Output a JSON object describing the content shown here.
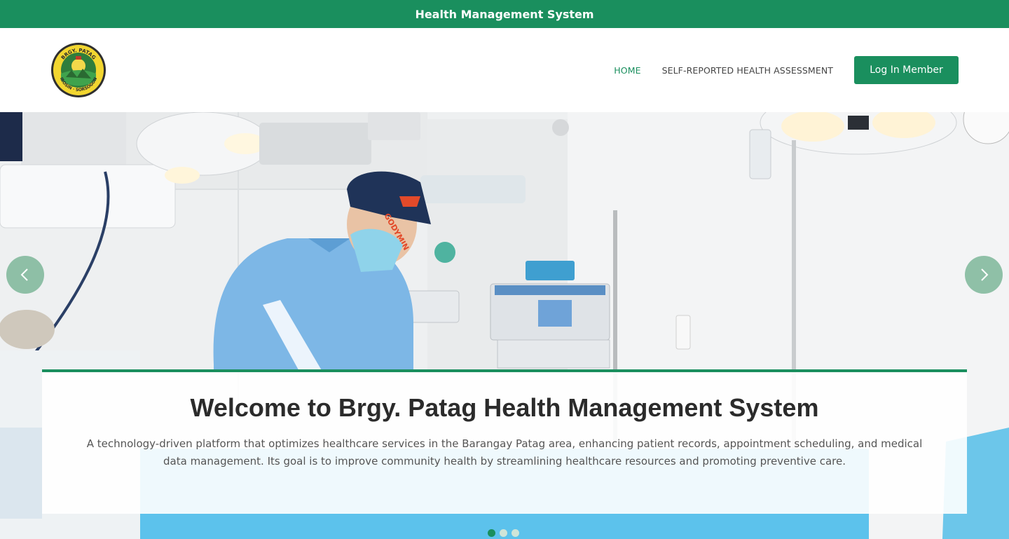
{
  "topbar": {
    "title": "Health Management System"
  },
  "logo": {
    "top_text": "BRGY. PATAG",
    "bottom_text": "IROSIN · SORSOGON"
  },
  "nav": {
    "items": [
      {
        "label": "HOME",
        "active": true
      },
      {
        "label": "SELF-REPORTED HEALTH ASSESSMENT",
        "active": false
      }
    ],
    "login_label": "Log In Member"
  },
  "hero": {
    "carousel_prev_icon": "chevron-left-icon",
    "carousel_next_icon": "chevron-right-icon",
    "slides": 3,
    "active_slide": 1,
    "cap_text": "GODYMIN"
  },
  "caption": {
    "title": "Welcome to Brgy. Patag Health Management System",
    "text": "A technology-driven platform that optimizes healthcare services in the Barangay Patag area, enhancing patient records, appointment scheduling, and medical data management. Its goal is to improve community health by streamlining healthcare resources and promoting preventive care."
  },
  "colors": {
    "brand": "#1a8f5e",
    "arrow": "#6eaf8c"
  }
}
